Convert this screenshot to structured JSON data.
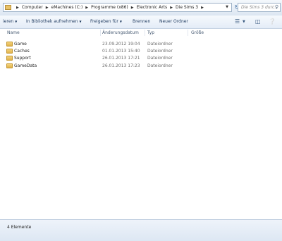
{
  "address": {
    "breadcrumbs": [
      "Computer",
      "eMachines (C:)",
      "Programme (x86)",
      "Electronic Arts",
      "Die Sims 3"
    ],
    "search_placeholder": "Die Sims 3 durc..."
  },
  "toolbar": {
    "organize_label": "ieren",
    "library_label": "In Bibliothek aufnehmen",
    "share_label": "Freigeben für",
    "burn_label": "Brennen",
    "new_folder_label": "Neuer Ordner",
    "icons": [
      "view-options-icon",
      "preview-pane-icon",
      "help-icon"
    ]
  },
  "columns": {
    "name": "Name",
    "date": "Änderungsdatum",
    "type": "Typ",
    "size": "Größe"
  },
  "files": [
    {
      "name": "Game",
      "date": "23.09.2012 19:04",
      "type": "Dateiordner",
      "icon": "folder-icon"
    },
    {
      "name": "Caches",
      "date": "01.01.2013 15:40",
      "type": "Dateiordner",
      "icon": "folder-icon"
    },
    {
      "name": "Support",
      "date": "26.01.2013 17:21",
      "type": "Dateiordner",
      "icon": "folder-icon"
    },
    {
      "name": "GameData",
      "date": "26.01.2013 17:23",
      "type": "Dateiordner",
      "icon": "folder-icon"
    }
  ],
  "status": {
    "item_count": "4 Elemente"
  }
}
